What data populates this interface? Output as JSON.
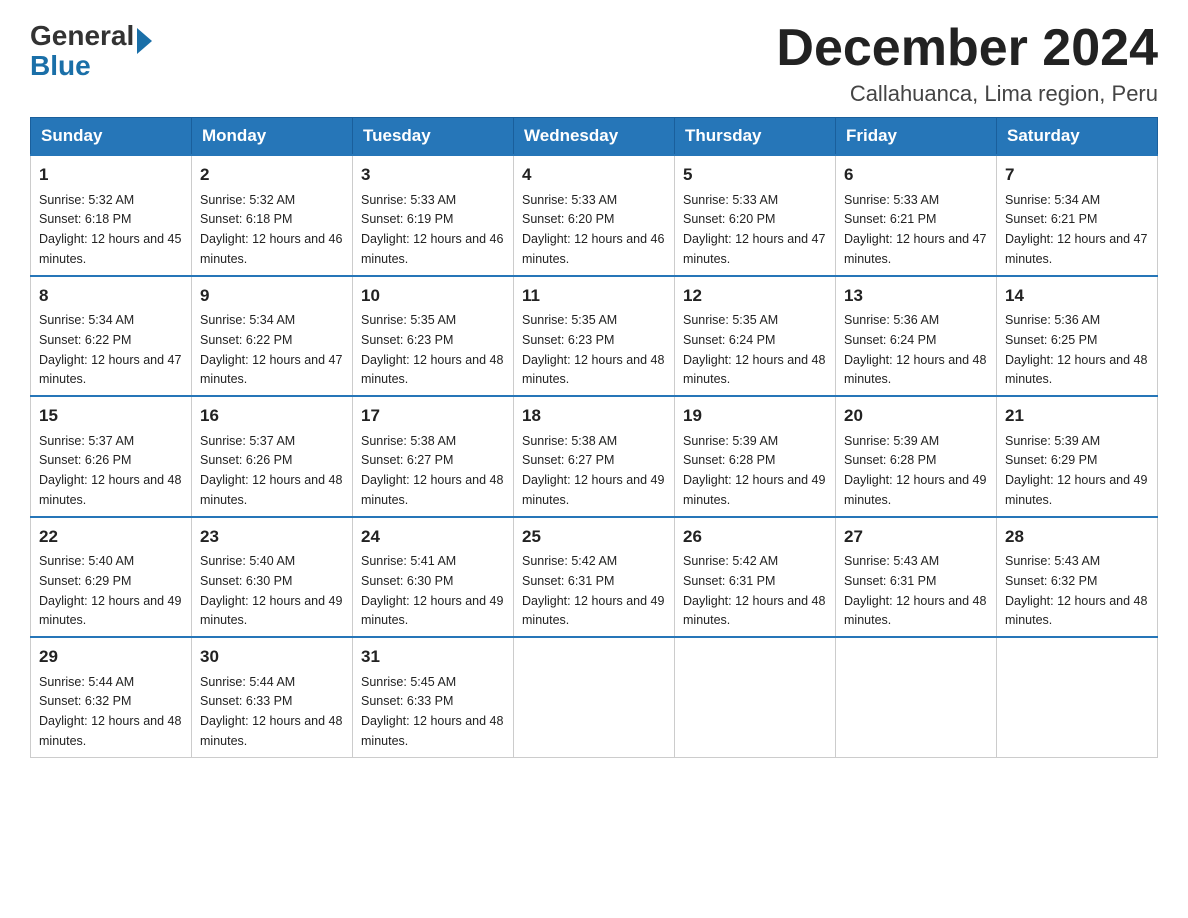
{
  "header": {
    "logo_general": "General",
    "logo_blue": "Blue",
    "month_title": "December 2024",
    "location": "Callahuanca, Lima region, Peru"
  },
  "weekdays": [
    "Sunday",
    "Monday",
    "Tuesday",
    "Wednesday",
    "Thursday",
    "Friday",
    "Saturday"
  ],
  "weeks": [
    [
      {
        "day": "1",
        "sunrise": "5:32 AM",
        "sunset": "6:18 PM",
        "daylight": "12 hours and 45 minutes."
      },
      {
        "day": "2",
        "sunrise": "5:32 AM",
        "sunset": "6:18 PM",
        "daylight": "12 hours and 46 minutes."
      },
      {
        "day": "3",
        "sunrise": "5:33 AM",
        "sunset": "6:19 PM",
        "daylight": "12 hours and 46 minutes."
      },
      {
        "day": "4",
        "sunrise": "5:33 AM",
        "sunset": "6:20 PM",
        "daylight": "12 hours and 46 minutes."
      },
      {
        "day": "5",
        "sunrise": "5:33 AM",
        "sunset": "6:20 PM",
        "daylight": "12 hours and 47 minutes."
      },
      {
        "day": "6",
        "sunrise": "5:33 AM",
        "sunset": "6:21 PM",
        "daylight": "12 hours and 47 minutes."
      },
      {
        "day": "7",
        "sunrise": "5:34 AM",
        "sunset": "6:21 PM",
        "daylight": "12 hours and 47 minutes."
      }
    ],
    [
      {
        "day": "8",
        "sunrise": "5:34 AM",
        "sunset": "6:22 PM",
        "daylight": "12 hours and 47 minutes."
      },
      {
        "day": "9",
        "sunrise": "5:34 AM",
        "sunset": "6:22 PM",
        "daylight": "12 hours and 47 minutes."
      },
      {
        "day": "10",
        "sunrise": "5:35 AM",
        "sunset": "6:23 PM",
        "daylight": "12 hours and 48 minutes."
      },
      {
        "day": "11",
        "sunrise": "5:35 AM",
        "sunset": "6:23 PM",
        "daylight": "12 hours and 48 minutes."
      },
      {
        "day": "12",
        "sunrise": "5:35 AM",
        "sunset": "6:24 PM",
        "daylight": "12 hours and 48 minutes."
      },
      {
        "day": "13",
        "sunrise": "5:36 AM",
        "sunset": "6:24 PM",
        "daylight": "12 hours and 48 minutes."
      },
      {
        "day": "14",
        "sunrise": "5:36 AM",
        "sunset": "6:25 PM",
        "daylight": "12 hours and 48 minutes."
      }
    ],
    [
      {
        "day": "15",
        "sunrise": "5:37 AM",
        "sunset": "6:26 PM",
        "daylight": "12 hours and 48 minutes."
      },
      {
        "day": "16",
        "sunrise": "5:37 AM",
        "sunset": "6:26 PM",
        "daylight": "12 hours and 48 minutes."
      },
      {
        "day": "17",
        "sunrise": "5:38 AM",
        "sunset": "6:27 PM",
        "daylight": "12 hours and 48 minutes."
      },
      {
        "day": "18",
        "sunrise": "5:38 AM",
        "sunset": "6:27 PM",
        "daylight": "12 hours and 49 minutes."
      },
      {
        "day": "19",
        "sunrise": "5:39 AM",
        "sunset": "6:28 PM",
        "daylight": "12 hours and 49 minutes."
      },
      {
        "day": "20",
        "sunrise": "5:39 AM",
        "sunset": "6:28 PM",
        "daylight": "12 hours and 49 minutes."
      },
      {
        "day": "21",
        "sunrise": "5:39 AM",
        "sunset": "6:29 PM",
        "daylight": "12 hours and 49 minutes."
      }
    ],
    [
      {
        "day": "22",
        "sunrise": "5:40 AM",
        "sunset": "6:29 PM",
        "daylight": "12 hours and 49 minutes."
      },
      {
        "day": "23",
        "sunrise": "5:40 AM",
        "sunset": "6:30 PM",
        "daylight": "12 hours and 49 minutes."
      },
      {
        "day": "24",
        "sunrise": "5:41 AM",
        "sunset": "6:30 PM",
        "daylight": "12 hours and 49 minutes."
      },
      {
        "day": "25",
        "sunrise": "5:42 AM",
        "sunset": "6:31 PM",
        "daylight": "12 hours and 49 minutes."
      },
      {
        "day": "26",
        "sunrise": "5:42 AM",
        "sunset": "6:31 PM",
        "daylight": "12 hours and 48 minutes."
      },
      {
        "day": "27",
        "sunrise": "5:43 AM",
        "sunset": "6:31 PM",
        "daylight": "12 hours and 48 minutes."
      },
      {
        "day": "28",
        "sunrise": "5:43 AM",
        "sunset": "6:32 PM",
        "daylight": "12 hours and 48 minutes."
      }
    ],
    [
      {
        "day": "29",
        "sunrise": "5:44 AM",
        "sunset": "6:32 PM",
        "daylight": "12 hours and 48 minutes."
      },
      {
        "day": "30",
        "sunrise": "5:44 AM",
        "sunset": "6:33 PM",
        "daylight": "12 hours and 48 minutes."
      },
      {
        "day": "31",
        "sunrise": "5:45 AM",
        "sunset": "6:33 PM",
        "daylight": "12 hours and 48 minutes."
      },
      null,
      null,
      null,
      null
    ]
  ],
  "labels": {
    "sunrise_prefix": "Sunrise: ",
    "sunset_prefix": "Sunset: ",
    "daylight_prefix": "Daylight: "
  }
}
